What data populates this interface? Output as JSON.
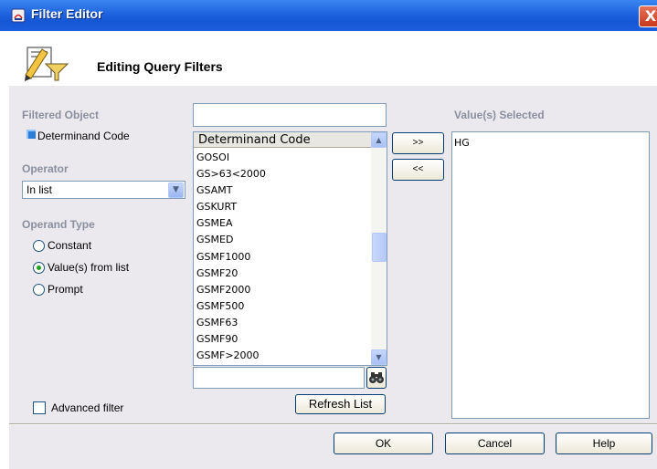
{
  "window": {
    "title": "Filter Editor",
    "close_glyph": "X"
  },
  "header": {
    "title": "Editing Query Filters",
    "icon": "filter-funnel-pencil-icon"
  },
  "left": {
    "filtered_object_label": "Filtered Object",
    "filtered_object_value": "Determinand Code",
    "operator_label": "Operator",
    "operator_value": "In list",
    "operand_type_label": "Operand Type",
    "operand_options": [
      "Constant",
      "Value(s) from list",
      "Prompt"
    ],
    "operand_selected": "Value(s) from list",
    "advanced_filter_label": "Advanced filter",
    "advanced_filter_checked": false
  },
  "middle": {
    "top_input_value": "",
    "list_header": "Determinand Code",
    "list_items": [
      "GOSOI",
      "GS>63<2000",
      "GSAMT",
      "GSKURT",
      "GSMEA",
      "GSMED",
      "GSMF1000",
      "GSMF20",
      "GSMF2000",
      "GSMF500",
      "GSMF63",
      "GSMF90",
      "GSMF>2000"
    ],
    "search_value": "",
    "refresh_label": "Refresh List"
  },
  "transfer": {
    "add_label": ">>",
    "remove_label": "<<"
  },
  "right": {
    "selected_label": "Value(s) Selected",
    "selected_values": [
      "HG"
    ]
  },
  "footer": {
    "ok_label": "OK",
    "cancel_label": "Cancel",
    "help_label": "Help"
  },
  "colors": {
    "titlebar": "#1f63de",
    "panel": "#ebe9ed",
    "label_gray": "#8a8fa0",
    "accent_blue": "#2c7fd8"
  }
}
